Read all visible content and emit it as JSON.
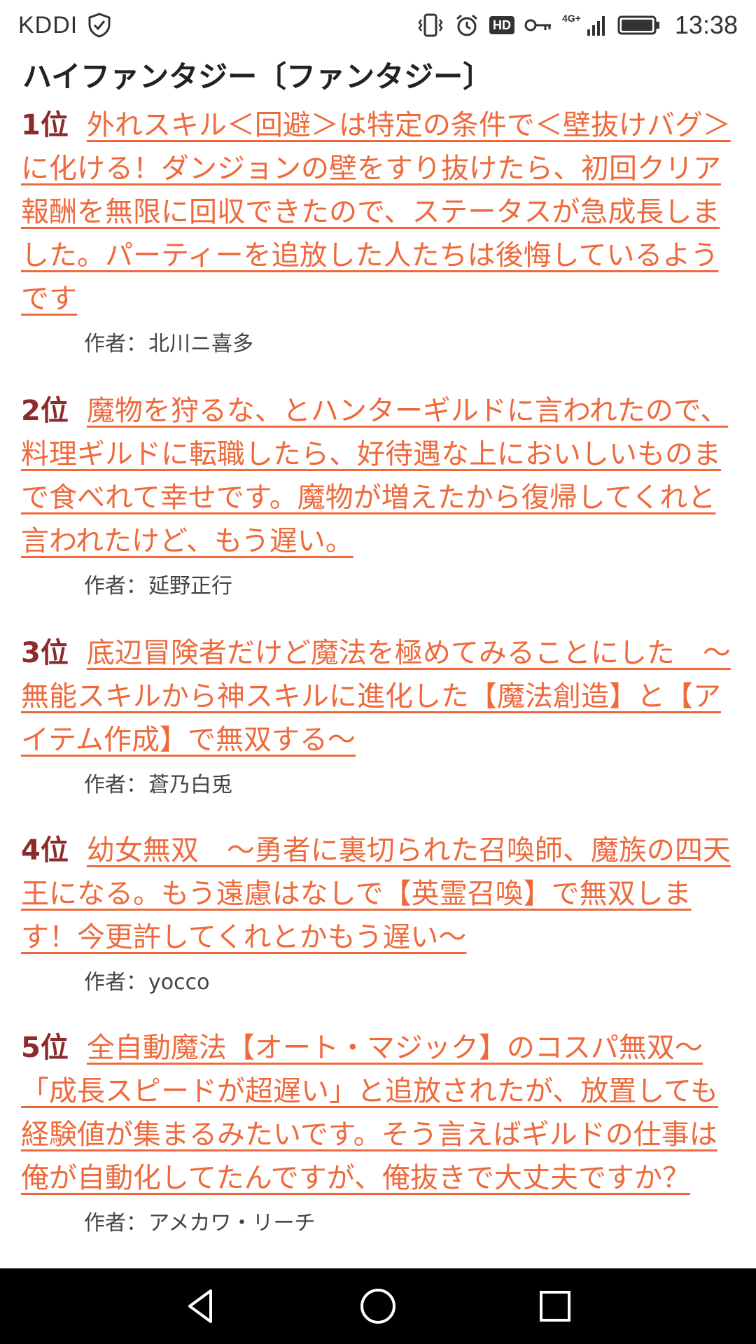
{
  "status_bar": {
    "carrier": "KDDI",
    "network": "4G+",
    "hd_badge": "HD",
    "time": "13:38",
    "icons": [
      "shield-check-icon",
      "vibrate-icon",
      "alarm-icon",
      "hd-icon",
      "vpn-key-icon",
      "signal-icon",
      "battery-icon"
    ]
  },
  "page": {
    "category_title": "ハイファンタジー〔ファンタジー〕"
  },
  "rankings": [
    {
      "rank": "1位",
      "title": "外れスキル＜回避＞は特定の条件で＜壁抜けバグ＞に化ける！ダンジョンの壁をすり抜けたら、初回クリア報酬を無限に回収できたので、ステータスが急成長しました。パーティーを追放した人たちは後悔しているようです",
      "author_label": "作者：",
      "author": "北川ニ喜多"
    },
    {
      "rank": "2位",
      "title": "魔物を狩るな、とハンターギルドに言われたので、料理ギルドに転職したら、好待遇な上においしいものまで食べれて幸せです。魔物が増えたから復帰してくれと言われたけど、もう遅い。",
      "author_label": "作者：",
      "author": "延野正行"
    },
    {
      "rank": "3位",
      "title": "底辺冒険者だけど魔法を極めてみることにした　～無能スキルから神スキルに進化した【魔法創造】と【アイテム作成】で無双する～",
      "author_label": "作者：",
      "author": "蒼乃白兎"
    },
    {
      "rank": "4位",
      "title": "幼女無双　～勇者に裏切られた召喚師、魔族の四天王になる。もう遠慮はなしで【英霊召喚】で無双します！今更許してくれとかもう遅い～",
      "author_label": "作者：",
      "author": "yocco"
    },
    {
      "rank": "5位",
      "title": "全自動魔法【オート・マジック】のコスパ無双～「成長スピードが超遅い」と追放されたが、放置しても経験値が集まるみたいです。そう言えばギルドの仕事は俺が自動化してたんですが、俺抜きで大丈夫ですか？",
      "author_label": "作者：",
      "author": "アメカワ・リーチ"
    }
  ],
  "nav_bar": {
    "buttons": [
      "back-icon",
      "home-icon",
      "recents-icon"
    ]
  },
  "colors": {
    "link": "#ee6a3c",
    "rank": "#8b2b2b",
    "text": "#222222",
    "nav_bg": "#000000"
  }
}
